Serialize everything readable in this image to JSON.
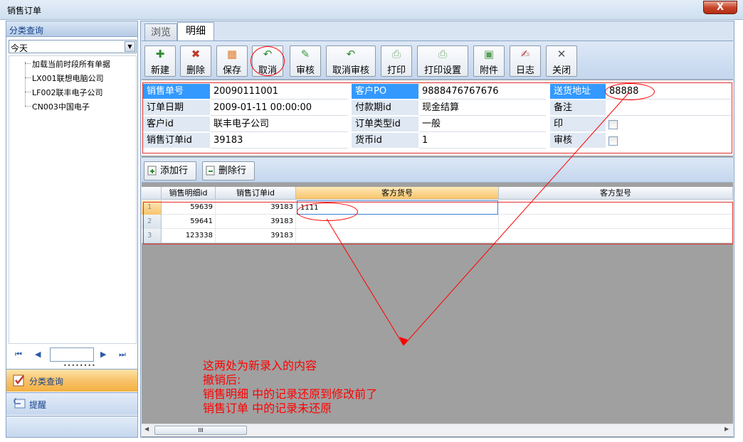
{
  "window": {
    "title": "销售订单",
    "close_label": "X"
  },
  "left": {
    "header": "分类查询",
    "range_value": "今天",
    "tree": [
      "加载当前时段所有单据",
      "LX001联想电脑公司",
      "LF002联丰电子公司",
      "CN003中国电子"
    ],
    "nav": {
      "first": "⏮",
      "prev": "◀",
      "next": "▶",
      "last": "⏭",
      "page_value": ""
    },
    "sections": {
      "active": "分类查询",
      "remind": "提醒"
    }
  },
  "tabs": {
    "browse": "浏览",
    "detail": "明细"
  },
  "toolbar": {
    "new": "新建",
    "delete": "删除",
    "save": "保存",
    "cancel": "取消",
    "audit": "审核",
    "unaudit": "取消审核",
    "print": "打印",
    "print_setup": "打印设置",
    "attach": "附件",
    "log": "日志",
    "close": "关闭"
  },
  "form": {
    "sales_no_label": "销售单号",
    "sales_no": "20090111001",
    "order_date_label": "订单日期",
    "order_date": "2009-01-11 00:00:00",
    "customer_label": "客户id",
    "customer": "联丰电子公司",
    "order_id_label": "销售订单id",
    "order_id": "39183",
    "po_label": "客户PO",
    "po": "9888476767676",
    "pay_label": "付款期id",
    "pay": "现金结算",
    "type_label": "订单类型id",
    "type": "一般",
    "currency_label": "货币id",
    "currency": "1",
    "addr_label": "送货地址",
    "addr": "88888",
    "note_label": "备注",
    "note": "",
    "print_label": "印",
    "audit_label": "审核"
  },
  "grid_toolbar": {
    "add_row": "添加行",
    "del_row": "删除行"
  },
  "grid": {
    "headers": [
      "销售明细id",
      "销售订单id",
      "客方货号",
      "客方型号"
    ],
    "rows": [
      {
        "n": "1",
        "detail_id": "59639",
        "order_id": "39183",
        "item_no": "1111",
        "model": ""
      },
      {
        "n": "2",
        "detail_id": "59641",
        "order_id": "39183",
        "item_no": "",
        "model": ""
      },
      {
        "n": "3",
        "detail_id": "123338",
        "order_id": "39183",
        "item_no": "",
        "model": ""
      }
    ]
  },
  "annotation": {
    "line1": "这两处为新录入的内容",
    "line2": "撤销后:",
    "line3": "销售明细 中的记录还原到修改前了",
    "line4": "销售订单 中的记录未还原"
  },
  "scroll": {
    "thumb": "III"
  },
  "colors": {
    "highlight": "#3399ff",
    "annotation": "#ff0000",
    "selected_header": "#f8c36a"
  }
}
